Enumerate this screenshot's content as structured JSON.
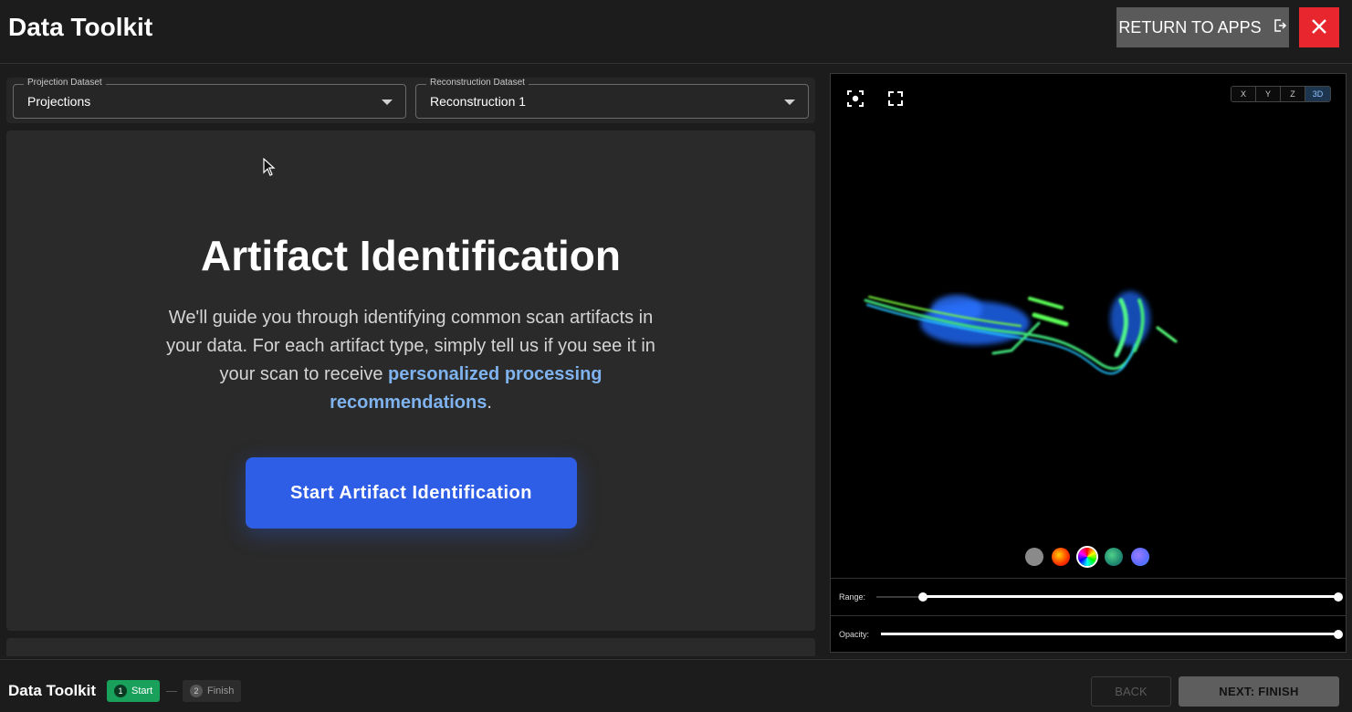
{
  "header": {
    "title": "Data Toolkit",
    "return_label": "RETURN TO APPS"
  },
  "selectors": {
    "projection": {
      "label": "Projection Dataset",
      "value": "Projections"
    },
    "reconstruction": {
      "label": "Reconstruction Dataset",
      "value": "Reconstruction 1"
    }
  },
  "intro": {
    "title": "Artifact Identification",
    "description_part1": "We'll guide you through identifying common scan artifacts in your data. For each artifact type, simply tell us if you see it in your scan to receive ",
    "description_highlight": "personalized processing recommendations",
    "description_end": ".",
    "start_button": "Start Artifact Identification"
  },
  "viewer": {
    "axis_buttons": [
      "X",
      "Y",
      "Z",
      "3D"
    ],
    "active_axis": "3D",
    "colormaps": [
      {
        "name": "gray",
        "color": "#8a8a8a"
      },
      {
        "name": "hot",
        "color": "#e83a10"
      },
      {
        "name": "rainbow",
        "color": "#ff00ff"
      },
      {
        "name": "viridis",
        "color": "#1f8a70"
      },
      {
        "name": "cool",
        "color": "#6b6cff"
      }
    ],
    "selected_colormap": "rainbow",
    "range_label": "Range:",
    "opacity_label": "Opacity:",
    "range_min": 0.1,
    "range_max": 1.0,
    "opacity": 1.0
  },
  "footer": {
    "title": "Data Toolkit",
    "steps": [
      {
        "num": "1",
        "label": "Start"
      },
      {
        "num": "2",
        "label": "Finish"
      }
    ],
    "back_label": "BACK",
    "next_label": "NEXT: FINISH"
  }
}
